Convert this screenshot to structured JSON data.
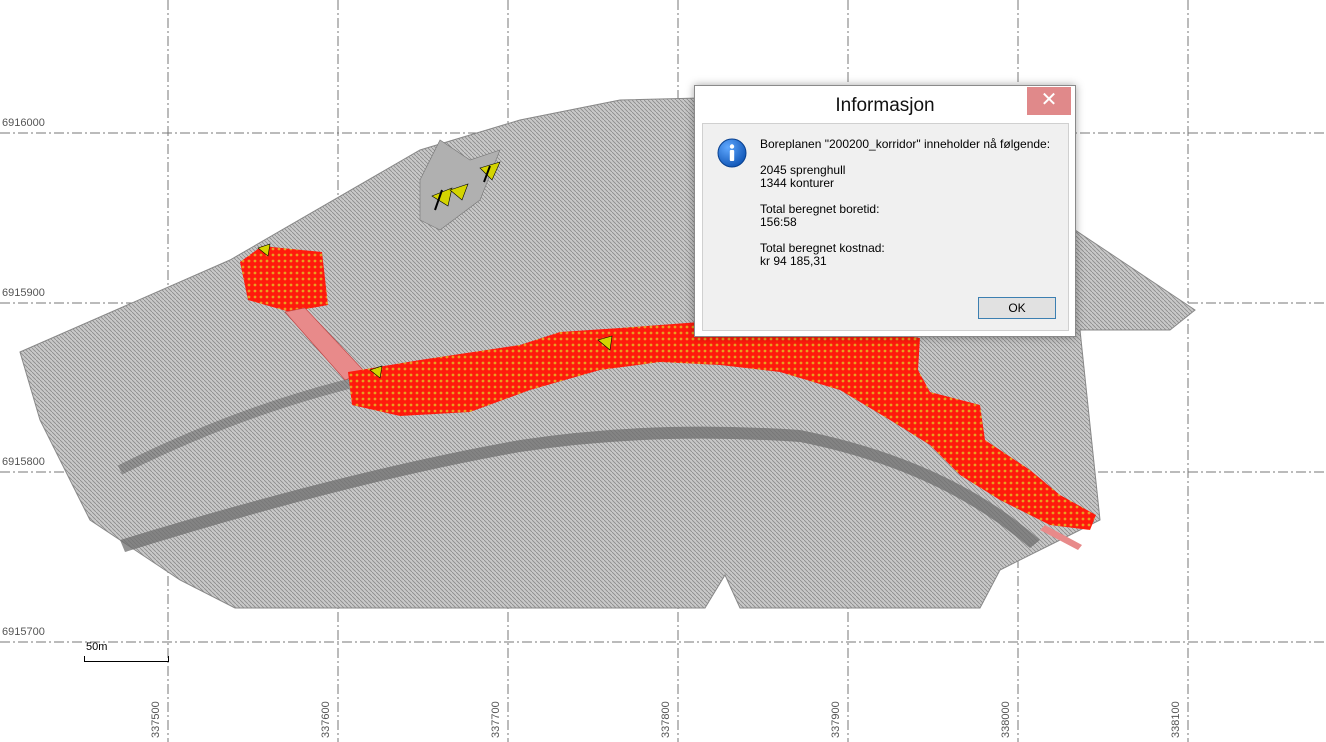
{
  "map": {
    "y_axis_labels": [
      "6916000",
      "6915900",
      "6915800",
      "6915700"
    ],
    "x_axis_labels": [
      "337500",
      "337600",
      "337700",
      "337800",
      "337900",
      "338000",
      "338100"
    ],
    "scalebar_label": "50m",
    "colors": {
      "terrain": "#9a9a9a",
      "drill_area": "#ff1a0d",
      "drill_holes": "#e8a020",
      "markers": "#d4d400",
      "grid": "#777777"
    }
  },
  "dialog": {
    "title": "Informasjon",
    "close_symbol": "✕",
    "icon": "info-icon",
    "message": {
      "intro": "Boreplanen \"200200_korridor\" inneholder nå følgende:",
      "holes": "2045 sprenghull",
      "contours": "1344 konturer",
      "time_label": "Total beregnet boretid:",
      "time_value": "156:58",
      "cost_label": "Total beregnet kostnad:",
      "cost_value": "kr 94 185,31"
    },
    "ok_label": "OK"
  }
}
